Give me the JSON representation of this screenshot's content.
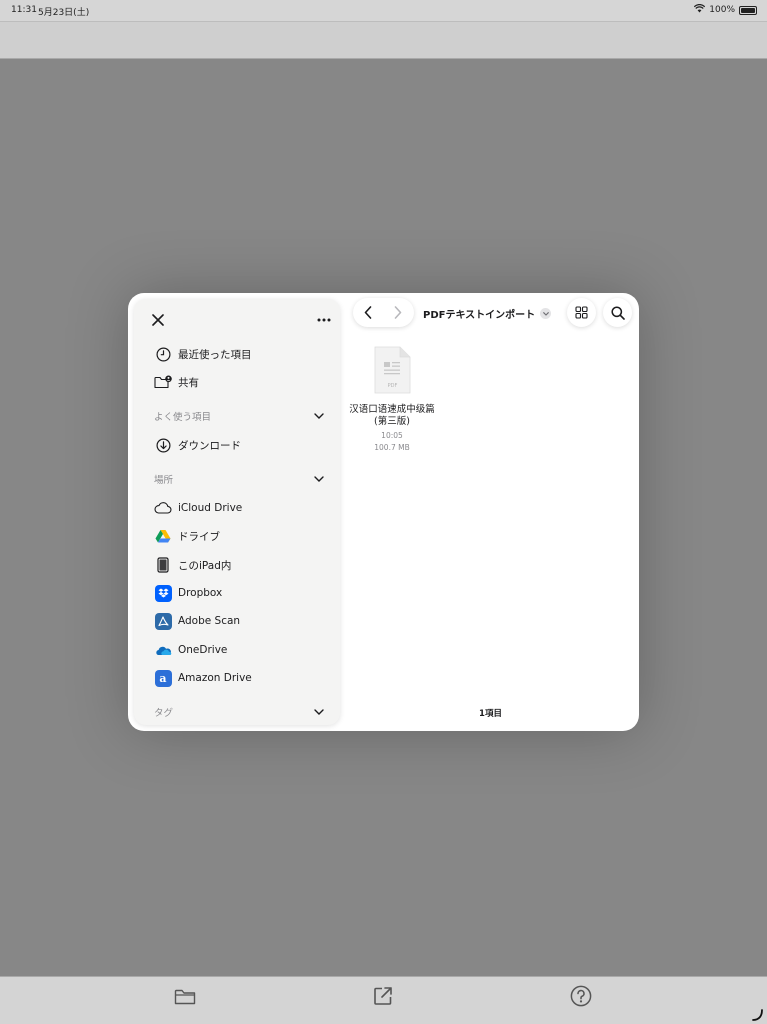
{
  "status": {
    "time": "11:31",
    "date": "5月23日(土)",
    "battery": "100%"
  },
  "sidebar": {
    "recents": "最近使った項目",
    "shared": "共有",
    "favorites_header": "よく使う項目",
    "downloads": "ダウンロード",
    "locations_header": "場所",
    "locations": [
      {
        "label": "iCloud Drive",
        "icon": "icloud-icon"
      },
      {
        "label": "ドライブ",
        "icon": "google-drive-icon"
      },
      {
        "label": "このiPad内",
        "icon": "ipad-icon"
      },
      {
        "label": "Dropbox",
        "icon": "dropbox-icon"
      },
      {
        "label": "Adobe Scan",
        "icon": "adobe-scan-icon"
      },
      {
        "label": "OneDrive",
        "icon": "onedrive-icon"
      },
      {
        "label": "Amazon Drive",
        "icon": "amazon-drive-icon"
      }
    ],
    "tags_header": "タグ"
  },
  "content": {
    "folder_title": "PDFテキストインポート",
    "file": {
      "name_line1": "汉语口语速成中级篇",
      "name_line2": "(第三版)",
      "date": "10:05",
      "size": "100.7 MB",
      "thumb_label": "PDF"
    },
    "item_count": "1項目"
  },
  "colors": {
    "dropbox": "#0061fe",
    "adobe": "#2d6aa8",
    "amazon": "#2c6fd8",
    "background": "#878787"
  }
}
